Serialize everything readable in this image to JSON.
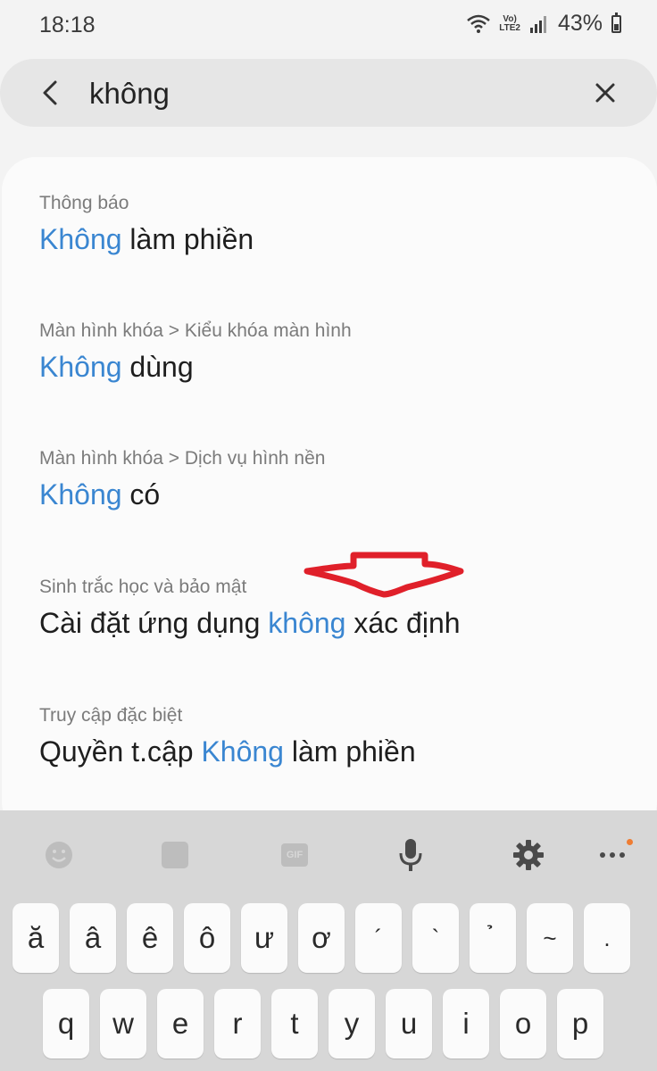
{
  "status_bar": {
    "time": "18:18",
    "network_label_top": "Vo)",
    "network_label_bottom": "LTE2",
    "battery_percent": "43%"
  },
  "search": {
    "query": "không",
    "back_icon": "arrow-back-icon",
    "clear_icon": "close-icon"
  },
  "results": [
    {
      "path": "Thông báo",
      "title_highlight": "Không",
      "title_before": "",
      "title_after": " làm phiền"
    },
    {
      "path": "Màn hình khóa > Kiểu khóa màn hình",
      "title_highlight": "Không",
      "title_before": "",
      "title_after": " dùng"
    },
    {
      "path": "Màn hình khóa > Dịch vụ hình nền",
      "title_highlight": "Không",
      "title_before": "",
      "title_after": " có"
    },
    {
      "path": "Sinh trắc học và bảo mật",
      "title_before": "Cài đặt ứng dụng ",
      "title_highlight": "không",
      "title_after": " xác định"
    },
    {
      "path": "Truy cập đặc biệt",
      "title_before": "Quyền t.cập ",
      "title_highlight": "Không",
      "title_after": " làm phiền"
    }
  ],
  "keyboard": {
    "toolbar": [
      {
        "icon": "emoji-icon"
      },
      {
        "icon": "sticker-icon"
      },
      {
        "icon": "gif-icon",
        "label": "GIF"
      },
      {
        "icon": "microphone-icon"
      },
      {
        "icon": "settings-gear-icon"
      },
      {
        "icon": "more-options-icon"
      }
    ],
    "row1": [
      "ă",
      "â",
      "ê",
      "ô",
      "ư",
      "ơ",
      "´",
      "`",
      "̉",
      "~",
      "."
    ],
    "row2": [
      "q",
      "w",
      "e",
      "r",
      "t",
      "y",
      "u",
      "i",
      "o",
      "p"
    ]
  },
  "colors": {
    "highlight": "#3a86d1",
    "annotation_arrow": "#e0202a",
    "keyboard_bg": "#d7d7d7",
    "key_bg": "#fbfbfb"
  }
}
